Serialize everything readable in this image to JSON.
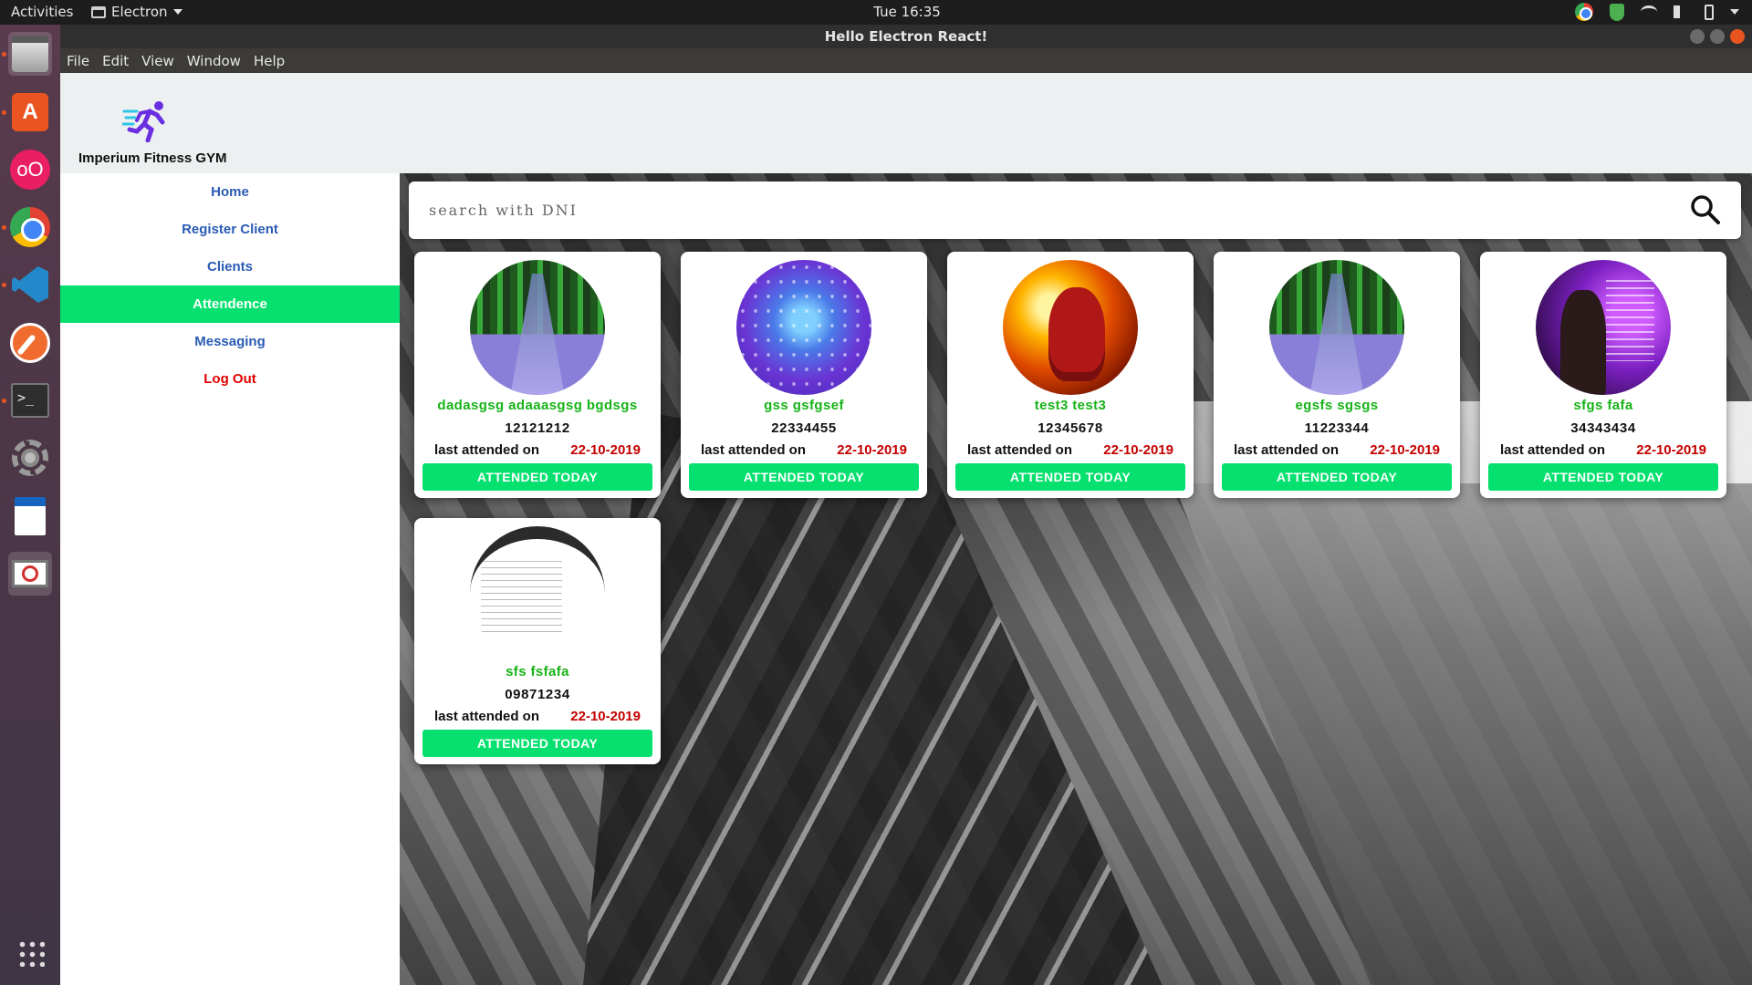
{
  "system": {
    "activities": "Activities",
    "app_menu": "Electron",
    "clock": "Tue 16:35"
  },
  "window": {
    "title": "Hello Electron React!",
    "menu": [
      "File",
      "Edit",
      "View",
      "Window",
      "Help"
    ]
  },
  "dock": {
    "icons": [
      "files-icon",
      "software-store-icon",
      "oo-icon",
      "chrome-icon",
      "vscode-icon",
      "postman-icon",
      "terminal-icon",
      "tools-icon",
      "writer-icon",
      "disabled-app-icon",
      "show-apps-icon"
    ],
    "terminal_glyph": ">_"
  },
  "brand": {
    "name": "Imperium Fitness GYM",
    "logo_color": "#6a2fe0",
    "logo_accent": "#2ec5e8"
  },
  "nav": {
    "items": [
      {
        "label": "Home"
      },
      {
        "label": "Register Client"
      },
      {
        "label": "Clients"
      },
      {
        "label": "Attendence",
        "active": true
      },
      {
        "label": "Messaging"
      },
      {
        "label": "Log Out"
      }
    ]
  },
  "search": {
    "placeholder": "search with DNI",
    "value": ""
  },
  "clients": [
    {
      "name": "dadasgsg adaaasgsg bgdsgs",
      "dni": "12121212",
      "last_label": "last attended on",
      "date": "22-10-2019",
      "button": "ATTENDED TODAY",
      "avatar": "forest"
    },
    {
      "name": "gss gsfgsef",
      "dni": "22334455",
      "last_label": "last attended on",
      "date": "22-10-2019",
      "button": "ATTENDED TODAY",
      "avatar": "desktop"
    },
    {
      "name": "test3 test3",
      "dni": "12345678",
      "last_label": "last attended on",
      "date": "22-10-2019",
      "button": "ATTENDED TODAY",
      "avatar": "flash"
    },
    {
      "name": "egsfs sgsgs",
      "dni": "11223344",
      "last_label": "last attended on",
      "date": "22-10-2019",
      "button": "ATTENDED TODAY",
      "avatar": "forest"
    },
    {
      "name": "sfgs fafa",
      "dni": "34343434",
      "last_label": "last attended on",
      "date": "22-10-2019",
      "button": "ATTENDED TODAY",
      "avatar": "purple"
    },
    {
      "name": "sfs fsfafa",
      "dni": "09871234",
      "last_label": "last attended on",
      "date": "22-10-2019",
      "button": "ATTENDED TODAY",
      "avatar": "screen"
    }
  ],
  "colors": {
    "accent_green": "#05e06e",
    "nav_blue": "#2a5bb5",
    "logout_red": "#e00000",
    "name_green": "#17b317",
    "date_red": "#c40000"
  }
}
